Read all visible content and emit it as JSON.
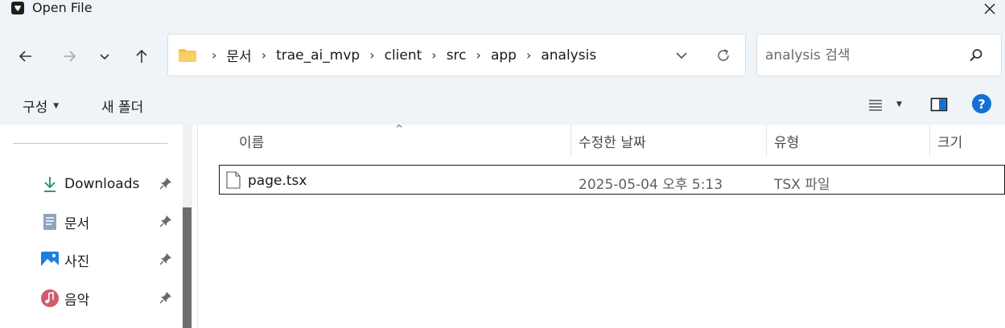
{
  "window": {
    "title": "Open File",
    "close_glyph": "✕"
  },
  "nav": {
    "back_glyph": "←",
    "forward_glyph": "→",
    "recent_glyph": "⌄",
    "up_glyph": "↑"
  },
  "address": {
    "sep": "›",
    "crumbs": [
      "문서",
      "trae_ai_mvp",
      "client",
      "src",
      "app",
      "analysis"
    ]
  },
  "search": {
    "placeholder": "analysis 검색"
  },
  "commands": {
    "organize": "구성",
    "organize_caret": "▼",
    "new_folder": "새 폴더",
    "view_caret": "▼",
    "help": "?"
  },
  "sidebar": {
    "items": [
      {
        "label": "Downloads",
        "icon": "download-icon"
      },
      {
        "label": "문서",
        "icon": "documents-icon"
      },
      {
        "label": "사진",
        "icon": "pictures-icon"
      },
      {
        "label": "음악",
        "icon": "music-icon"
      }
    ]
  },
  "columns": {
    "name": "이름",
    "modified": "수정한 날짜",
    "type": "유형",
    "size": "크기",
    "sort_glyph": "^"
  },
  "files": [
    {
      "name": "page.tsx",
      "modified": "2025-05-04 오후 5:13",
      "type": "TSX 파일",
      "size": ""
    }
  ],
  "colors": {
    "chrome": "#eff4f9",
    "accent": "#1570d6",
    "folder": "#f5c542"
  }
}
